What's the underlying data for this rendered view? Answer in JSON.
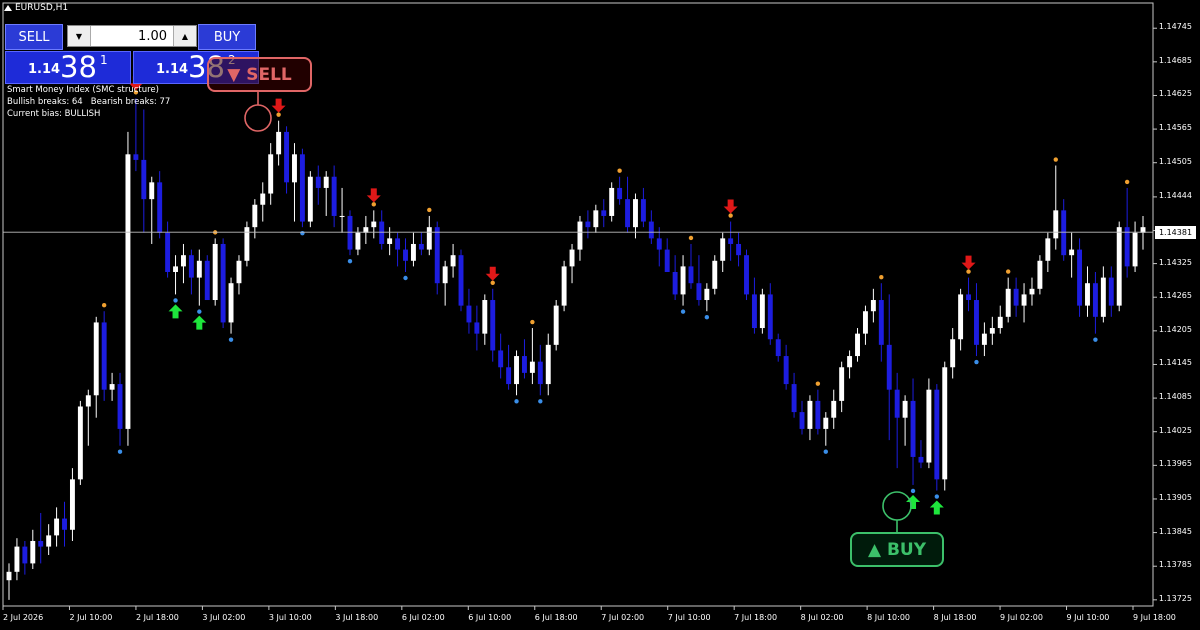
{
  "window": {
    "title": "EURUSD,H1"
  },
  "trade_panel": {
    "sell_label": "SELL",
    "buy_label": "BUY",
    "lot_value": "1.00",
    "sell_price_big": "1.14",
    "sell_price_main": "38",
    "sell_price_sup": "1",
    "buy_price_big": "1.14",
    "buy_price_main": "38",
    "buy_price_sup": "2"
  },
  "indicator_info": {
    "line1": "Smart Money Index (SMC structure)",
    "line2": "Bullish breaks: 64   Bearish breaks: 77",
    "line3": "Current bias: BULLISH"
  },
  "annotations": {
    "sell_badge": "▼ SELL",
    "buy_badge": "▲ BUY"
  },
  "colors": {
    "bull": "#ffffff",
    "bear": "#1d1de0",
    "buy_arrow": "#1ee63c",
    "sell_arrow": "#e01818",
    "high_dot": "#f0a030",
    "low_dot": "#3a8ee8",
    "sell_color": "#e06666",
    "buy_color": "#3cc06a"
  },
  "chart_data": {
    "type": "candlestick",
    "symbol": "EURUSD",
    "timeframe": "H1",
    "current_price": "1.14381",
    "y_ticks": [
      "1.14745",
      "1.14685",
      "1.14625",
      "1.14565",
      "1.14505",
      "1.14444",
      "1.14384",
      "1.14325",
      "1.14265",
      "1.14205",
      "1.14145",
      "1.14085",
      "1.14025",
      "1.13965",
      "1.13905",
      "1.13845",
      "1.13785",
      "1.13725"
    ],
    "x_ticks": [
      "2 Jul 2026",
      "2 Jul 10:00",
      "2 Jul 18:00",
      "3 Jul 02:00",
      "3 Jul 10:00",
      "3 Jul 18:00",
      "6 Jul 02:00",
      "6 Jul 10:00",
      "6 Jul 18:00",
      "7 Jul 02:00",
      "7 Jul 10:00",
      "7 Jul 18:00",
      "8 Jul 02:00",
      "8 Jul 10:00",
      "8 Jul 18:00",
      "9 Jul 02:00",
      "9 Jul 10:00",
      "9 Jul 18:00"
    ],
    "ylim": [
      1.13714,
      1.1479
    ],
    "candles": [
      [
        1.1376,
        1.1379,
        1.13725,
        1.13775
      ],
      [
        1.13775,
        1.13835,
        1.1376,
        1.1382
      ],
      [
        1.1382,
        1.1383,
        1.1377,
        1.1379
      ],
      [
        1.1379,
        1.1385,
        1.1378,
        1.1383
      ],
      [
        1.1383,
        1.1388,
        1.1379,
        1.1382
      ],
      [
        1.1382,
        1.1386,
        1.13805,
        1.1384
      ],
      [
        1.1384,
        1.1389,
        1.1382,
        1.1387
      ],
      [
        1.1387,
        1.139,
        1.1382,
        1.1385
      ],
      [
        1.1385,
        1.1396,
        1.1383,
        1.1394
      ],
      [
        1.1394,
        1.1408,
        1.1393,
        1.1407
      ],
      [
        1.1407,
        1.141,
        1.14,
        1.1409
      ],
      [
        1.1409,
        1.1423,
        1.1405,
        1.1422
      ],
      [
        1.1422,
        1.1424,
        1.1408,
        1.141
      ],
      [
        1.141,
        1.1413,
        1.1408,
        1.1411
      ],
      [
        1.1411,
        1.1413,
        1.14,
        1.1403
      ],
      [
        1.1403,
        1.1456,
        1.14,
        1.1452
      ],
      [
        1.1452,
        1.1462,
        1.1449,
        1.1451
      ],
      [
        1.1451,
        1.146,
        1.1438,
        1.1444
      ],
      [
        1.1444,
        1.1448,
        1.1436,
        1.1447
      ],
      [
        1.1447,
        1.1449,
        1.1437,
        1.1438
      ],
      [
        1.1438,
        1.144,
        1.143,
        1.1431
      ],
      [
        1.1431,
        1.1434,
        1.1427,
        1.1432
      ],
      [
        1.1432,
        1.1436,
        1.1429,
        1.1434
      ],
      [
        1.1434,
        1.1435,
        1.1427,
        1.143
      ],
      [
        1.143,
        1.1435,
        1.1425,
        1.1433
      ],
      [
        1.1433,
        1.1434,
        1.1427,
        1.1426
      ],
      [
        1.1426,
        1.1437,
        1.1425,
        1.1436
      ],
      [
        1.1436,
        1.1437,
        1.1421,
        1.1422
      ],
      [
        1.1422,
        1.143,
        1.142,
        1.1429
      ],
      [
        1.1429,
        1.1434,
        1.1427,
        1.1433
      ],
      [
        1.1433,
        1.144,
        1.1432,
        1.1439
      ],
      [
        1.1439,
        1.1444,
        1.1437,
        1.1443
      ],
      [
        1.1443,
        1.1447,
        1.144,
        1.1445
      ],
      [
        1.1445,
        1.1454,
        1.1443,
        1.1452
      ],
      [
        1.1452,
        1.1458,
        1.145,
        1.1456
      ],
      [
        1.1456,
        1.1457,
        1.1445,
        1.1447
      ],
      [
        1.1447,
        1.1454,
        1.144,
        1.1452
      ],
      [
        1.1452,
        1.1453,
        1.1439,
        1.144
      ],
      [
        1.144,
        1.1449,
        1.1439,
        1.1448
      ],
      [
        1.1448,
        1.145,
        1.1443,
        1.1446
      ],
      [
        1.1446,
        1.1449,
        1.1441,
        1.1448
      ],
      [
        1.1448,
        1.145,
        1.1439,
        1.1441
      ],
      [
        1.1441,
        1.1446,
        1.1438,
        1.1441
      ],
      [
        1.1441,
        1.1442,
        1.1434,
        1.1435
      ],
      [
        1.1435,
        1.1439,
        1.1434,
        1.1438
      ],
      [
        1.1438,
        1.1441,
        1.1436,
        1.1439
      ],
      [
        1.1439,
        1.1442,
        1.1437,
        1.144
      ],
      [
        1.144,
        1.1442,
        1.1435,
        1.1436
      ],
      [
        1.1436,
        1.1439,
        1.1434,
        1.1437
      ],
      [
        1.1437,
        1.1438,
        1.1432,
        1.1435
      ],
      [
        1.1435,
        1.1437,
        1.1431,
        1.1433
      ],
      [
        1.1433,
        1.1438,
        1.1432,
        1.1436
      ],
      [
        1.1436,
        1.1438,
        1.1434,
        1.1435
      ],
      [
        1.1435,
        1.1441,
        1.1434,
        1.1439
      ],
      [
        1.1439,
        1.144,
        1.1427,
        1.1429
      ],
      [
        1.1429,
        1.1433,
        1.1425,
        1.1432
      ],
      [
        1.1432,
        1.1436,
        1.143,
        1.1434
      ],
      [
        1.1434,
        1.1435,
        1.1424,
        1.1425
      ],
      [
        1.1425,
        1.1428,
        1.142,
        1.1422
      ],
      [
        1.1422,
        1.1425,
        1.1417,
        1.142
      ],
      [
        1.142,
        1.1427,
        1.1418,
        1.1426
      ],
      [
        1.1426,
        1.1428,
        1.1415,
        1.1417
      ],
      [
        1.1417,
        1.142,
        1.1412,
        1.1414
      ],
      [
        1.1414,
        1.1418,
        1.141,
        1.1411
      ],
      [
        1.1411,
        1.1417,
        1.1409,
        1.1416
      ],
      [
        1.1416,
        1.1419,
        1.1412,
        1.1413
      ],
      [
        1.1413,
        1.1421,
        1.1411,
        1.1415
      ],
      [
        1.1415,
        1.1418,
        1.1409,
        1.1411
      ],
      [
        1.1411,
        1.142,
        1.1409,
        1.1418
      ],
      [
        1.1418,
        1.1426,
        1.1417,
        1.1425
      ],
      [
        1.1425,
        1.1433,
        1.1424,
        1.1432
      ],
      [
        1.1432,
        1.1436,
        1.1429,
        1.1435
      ],
      [
        1.1435,
        1.1441,
        1.1433,
        1.144
      ],
      [
        1.144,
        1.1442,
        1.1437,
        1.1439
      ],
      [
        1.1439,
        1.1443,
        1.1438,
        1.1442
      ],
      [
        1.1442,
        1.1444,
        1.1439,
        1.1441
      ],
      [
        1.1441,
        1.1447,
        1.144,
        1.1446
      ],
      [
        1.1446,
        1.1448,
        1.1443,
        1.1444
      ],
      [
        1.1444,
        1.1448,
        1.1438,
        1.1439
      ],
      [
        1.1439,
        1.1445,
        1.1437,
        1.1444
      ],
      [
        1.1444,
        1.1446,
        1.1439,
        1.144
      ],
      [
        1.144,
        1.1442,
        1.1436,
        1.1437
      ],
      [
        1.1437,
        1.1439,
        1.1432,
        1.1435
      ],
      [
        1.1435,
        1.1437,
        1.1432,
        1.1431
      ],
      [
        1.1431,
        1.1434,
        1.1426,
        1.1427
      ],
      [
        1.1427,
        1.1434,
        1.1425,
        1.1432
      ],
      [
        1.1432,
        1.1436,
        1.1428,
        1.1429
      ],
      [
        1.1429,
        1.1434,
        1.1425,
        1.1426
      ],
      [
        1.1426,
        1.1429,
        1.1424,
        1.1428
      ],
      [
        1.1428,
        1.1434,
        1.1427,
        1.1433
      ],
      [
        1.1433,
        1.1438,
        1.1431,
        1.1437
      ],
      [
        1.1437,
        1.144,
        1.1433,
        1.1436
      ],
      [
        1.1436,
        1.1438,
        1.1432,
        1.1434
      ],
      [
        1.1434,
        1.1435,
        1.1426,
        1.1427
      ],
      [
        1.1427,
        1.143,
        1.142,
        1.1421
      ],
      [
        1.1421,
        1.1428,
        1.142,
        1.1427
      ],
      [
        1.1427,
        1.1429,
        1.1418,
        1.1419
      ],
      [
        1.1419,
        1.142,
        1.1415,
        1.1416
      ],
      [
        1.1416,
        1.1418,
        1.141,
        1.1411
      ],
      [
        1.1411,
        1.1413,
        1.1405,
        1.1406
      ],
      [
        1.1406,
        1.1408,
        1.1402,
        1.1403
      ],
      [
        1.1403,
        1.1409,
        1.1401,
        1.1408
      ],
      [
        1.1408,
        1.141,
        1.1402,
        1.1403
      ],
      [
        1.1403,
        1.1406,
        1.14,
        1.1405
      ],
      [
        1.1405,
        1.141,
        1.1403,
        1.1408
      ],
      [
        1.1408,
        1.1415,
        1.1406,
        1.1414
      ],
      [
        1.1414,
        1.1417,
        1.1412,
        1.1416
      ],
      [
        1.1416,
        1.1421,
        1.1415,
        1.142
      ],
      [
        1.142,
        1.1425,
        1.1418,
        1.1424
      ],
      [
        1.1424,
        1.1428,
        1.1422,
        1.1426
      ],
      [
        1.1426,
        1.1429,
        1.1415,
        1.1418
      ],
      [
        1.1418,
        1.1427,
        1.1401,
        1.141
      ],
      [
        1.141,
        1.1413,
        1.1396,
        1.1405
      ],
      [
        1.1405,
        1.1409,
        1.14,
        1.1408
      ],
      [
        1.1408,
        1.1412,
        1.1393,
        1.1398
      ],
      [
        1.1398,
        1.1401,
        1.1396,
        1.1397
      ],
      [
        1.1397,
        1.1412,
        1.1396,
        1.141
      ],
      [
        1.141,
        1.1411,
        1.1392,
        1.1394
      ],
      [
        1.1394,
        1.1415,
        1.1392,
        1.1414
      ],
      [
        1.1414,
        1.1421,
        1.1412,
        1.1419
      ],
      [
        1.1419,
        1.1428,
        1.1417,
        1.1427
      ],
      [
        1.1427,
        1.143,
        1.1424,
        1.1426
      ],
      [
        1.1426,
        1.1429,
        1.1416,
        1.1418
      ],
      [
        1.1418,
        1.1422,
        1.1416,
        1.142
      ],
      [
        1.142,
        1.1423,
        1.1418,
        1.1421
      ],
      [
        1.1421,
        1.1425,
        1.142,
        1.1423
      ],
      [
        1.1423,
        1.143,
        1.1422,
        1.1428
      ],
      [
        1.1428,
        1.143,
        1.1423,
        1.1425
      ],
      [
        1.1425,
        1.1429,
        1.1422,
        1.1427
      ],
      [
        1.1427,
        1.143,
        1.1425,
        1.1428
      ],
      [
        1.1428,
        1.1434,
        1.1427,
        1.1433
      ],
      [
        1.1433,
        1.1438,
        1.1431,
        1.1437
      ],
      [
        1.1437,
        1.145,
        1.1435,
        1.1442
      ],
      [
        1.1442,
        1.1444,
        1.1433,
        1.1434
      ],
      [
        1.1434,
        1.1438,
        1.143,
        1.1435
      ],
      [
        1.1435,
        1.1437,
        1.1423,
        1.1425
      ],
      [
        1.1425,
        1.1432,
        1.1423,
        1.1429
      ],
      [
        1.1429,
        1.1431,
        1.142,
        1.1423
      ],
      [
        1.1423,
        1.1432,
        1.1422,
        1.143
      ],
      [
        1.143,
        1.1432,
        1.1423,
        1.1425
      ],
      [
        1.1425,
        1.144,
        1.1424,
        1.1439
      ],
      [
        1.1439,
        1.1446,
        1.143,
        1.1432
      ],
      [
        1.1432,
        1.144,
        1.1431,
        1.1438
      ],
      [
        1.1438,
        1.1441,
        1.1435,
        1.1439
      ]
    ]
  }
}
